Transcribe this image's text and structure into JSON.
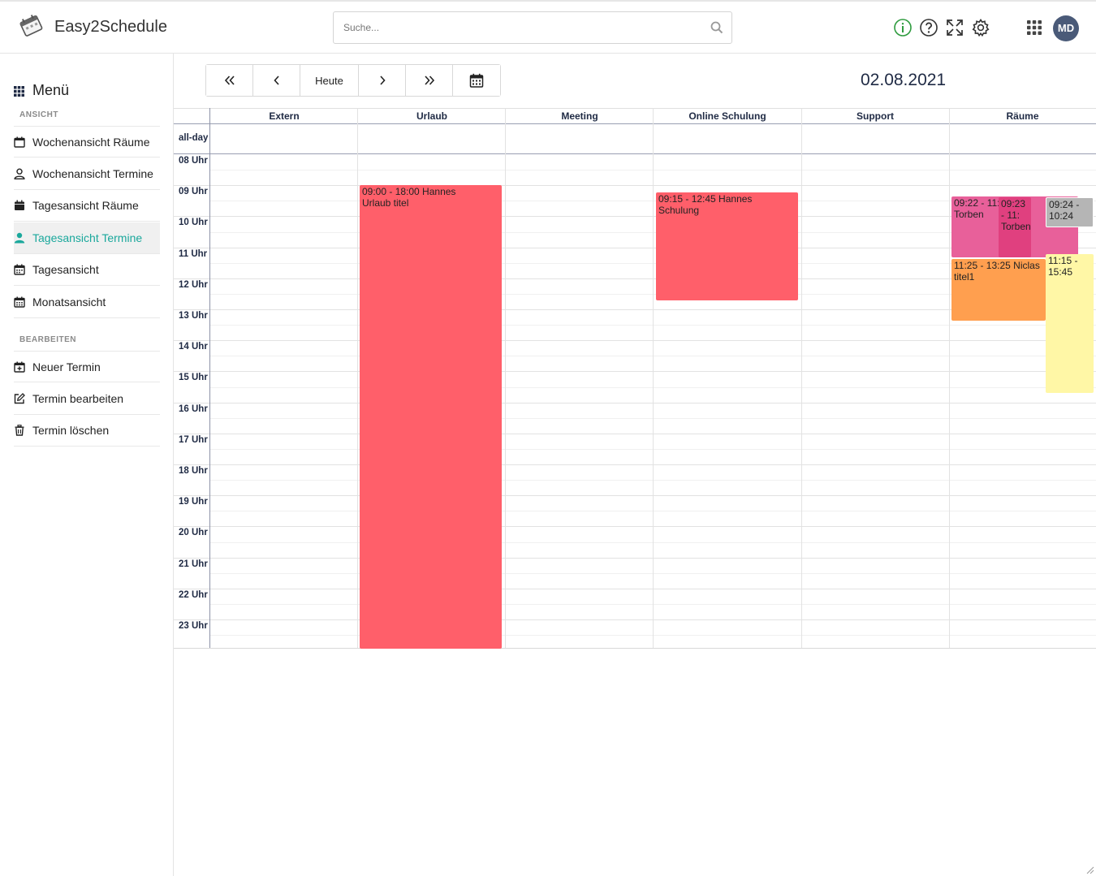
{
  "app": {
    "title": "Easy2Schedule"
  },
  "search": {
    "placeholder": "Suche..."
  },
  "user": {
    "initials": "MD"
  },
  "sidebar": {
    "menu_title": "Menü",
    "section_view": "ANSICHT",
    "section_edit": "BEARBEITEN",
    "view_items": [
      {
        "label": "Wochenansicht Räume",
        "icon": "calendar-outline-icon"
      },
      {
        "label": "Wochenansicht Termine",
        "icon": "user-outline-icon"
      },
      {
        "label": "Tagesansicht Räume",
        "icon": "calendar-solid-icon"
      },
      {
        "label": "Tagesansicht Termine",
        "icon": "user-solid-icon",
        "active": true
      },
      {
        "label": "Tagesansicht",
        "icon": "calendar-days-icon"
      },
      {
        "label": "Monatsansicht",
        "icon": "calendar-month-icon"
      }
    ],
    "edit_items": [
      {
        "label": "Neuer Termin",
        "icon": "calendar-plus-icon"
      },
      {
        "label": "Termin bearbeiten",
        "icon": "edit-icon"
      },
      {
        "label": "Termin löschen",
        "icon": "trash-icon"
      }
    ]
  },
  "toolbar": {
    "today_label": "Heute"
  },
  "calendar": {
    "date": "02.08.2021",
    "allday_label": "all-day",
    "columns": [
      "Extern",
      "Urlaub",
      "Meeting",
      "Online Schulung",
      "Support",
      "Räume"
    ],
    "hours": [
      "08 Uhr",
      "09 Uhr",
      "10 Uhr",
      "11 Uhr",
      "12 Uhr",
      "13 Uhr",
      "14 Uhr",
      "15 Uhr",
      "16 Uhr",
      "17 Uhr",
      "18 Uhr",
      "19 Uhr",
      "20 Uhr",
      "21 Uhr",
      "22 Uhr",
      "23 Uhr"
    ],
    "events": [
      {
        "line1": "09:00 - 18:00 Hannes",
        "line2": "Urlaub titel",
        "color": "#ff5f6a"
      },
      {
        "line1": "09:15 - 12:45 Hannes",
        "line2": "Schulung",
        "color": "#ff5f6a"
      },
      {
        "line1": "09:22 - 11:",
        "line2": "Torben",
        "color": "#e8609a"
      },
      {
        "line1": "09:23 - 11:",
        "line2": "Torben",
        "color": "#e0407f"
      },
      {
        "line1": "09:24 -",
        "line2": "10:24",
        "color": "#b5b5b5"
      },
      {
        "line1": "11:25 - 13:25 Niclas",
        "line2": "titel1",
        "color": "#ff9f4f"
      },
      {
        "line1": "11:15 -",
        "line2": "15:45",
        "color": "#fff7a6"
      }
    ]
  },
  "colors": {
    "accent": "#1aa89c",
    "event_red": "#ff5f6a",
    "header_text": "#1f2a44"
  }
}
